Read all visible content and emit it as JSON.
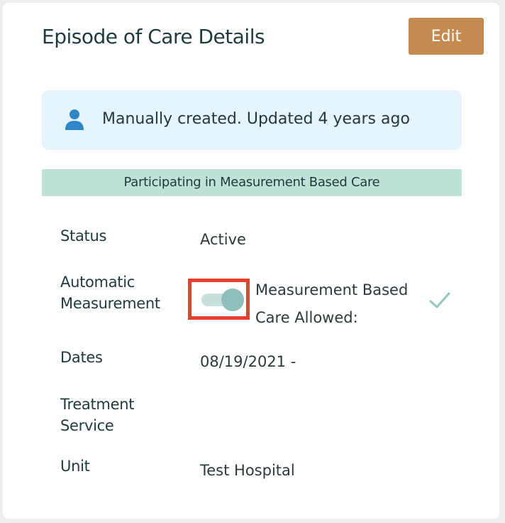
{
  "card": {
    "title": "Episode of Care Details",
    "edit_label": "Edit"
  },
  "info": {
    "icon": "user-icon",
    "text": "Manually created. Updated 4 years ago"
  },
  "banner": {
    "text": "Participating in Measurement Based Care"
  },
  "fields": {
    "status": {
      "label": "Status",
      "value": "Active"
    },
    "automatic_measurement": {
      "label_line1": "Automatic",
      "label_line2": "Measurement",
      "toggle_on": true,
      "allowed_line1": "Measurement Based",
      "allowed_line2": "Care Allowed:",
      "allowed_icon": "check-icon"
    },
    "dates": {
      "label": "Dates",
      "value": "08/19/2021 -"
    },
    "treatment_service": {
      "label_line1": "Treatment",
      "label_line2": "Service",
      "value": ""
    },
    "unit": {
      "label": "Unit",
      "value": "Test Hospital"
    }
  },
  "colors": {
    "accent_button": "#c48a4f",
    "info_bg": "#e6f4fb",
    "banner_bg": "#bfe2d6",
    "highlight_box": "#e8402c",
    "toggle_knob": "#8fbfbb",
    "check": "#8fc6bd"
  }
}
